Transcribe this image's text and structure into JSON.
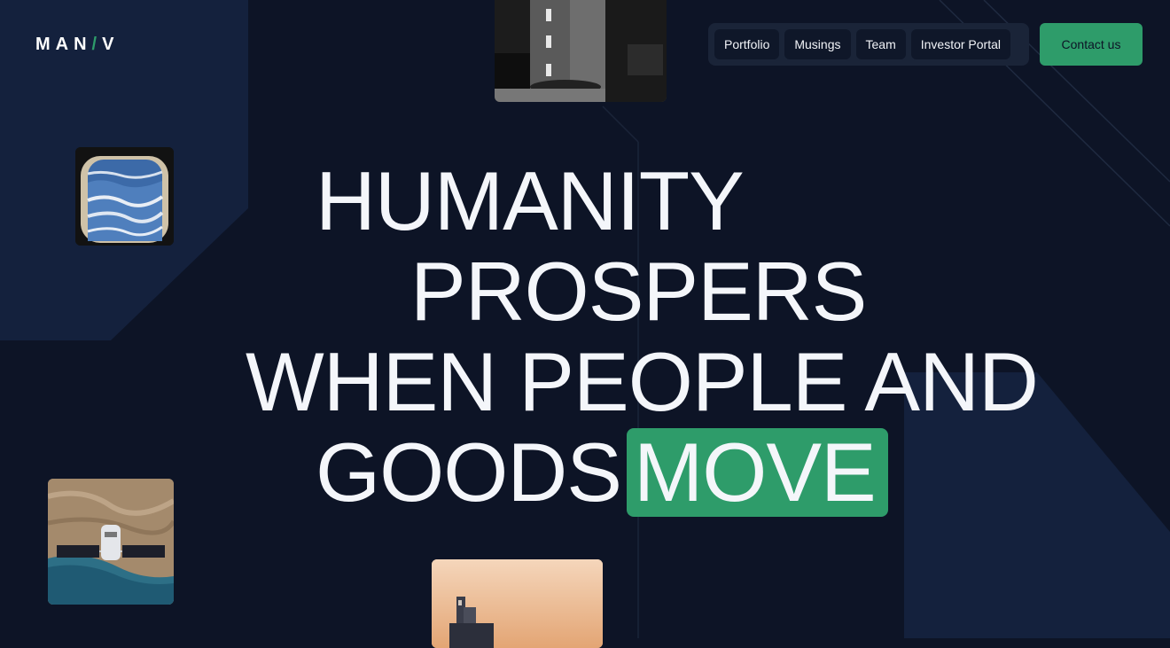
{
  "brand": {
    "logo_part1": "MAN",
    "logo_slash": "/",
    "logo_part2": "V"
  },
  "nav": {
    "items": [
      {
        "label": "Portfolio"
      },
      {
        "label": "Musings"
      },
      {
        "label": "Team"
      },
      {
        "label": "Investor Portal"
      }
    ],
    "contact_label": "Contact us"
  },
  "hero": {
    "line1": "HUMANITY",
    "line2": "PROSPERS",
    "line3": "WHEN PEOPLE AND",
    "line4": "GOODS",
    "highlight": "MOVE"
  },
  "images": [
    {
      "icon": "road-traffic-photo"
    },
    {
      "icon": "airplane-window-photo"
    },
    {
      "icon": "satellite-photo"
    },
    {
      "icon": "ship-photo"
    }
  ],
  "colors": {
    "background": "#0d1426",
    "panel": "#14213d",
    "accent": "#2e9c6a",
    "text": "#f4f6fa"
  }
}
